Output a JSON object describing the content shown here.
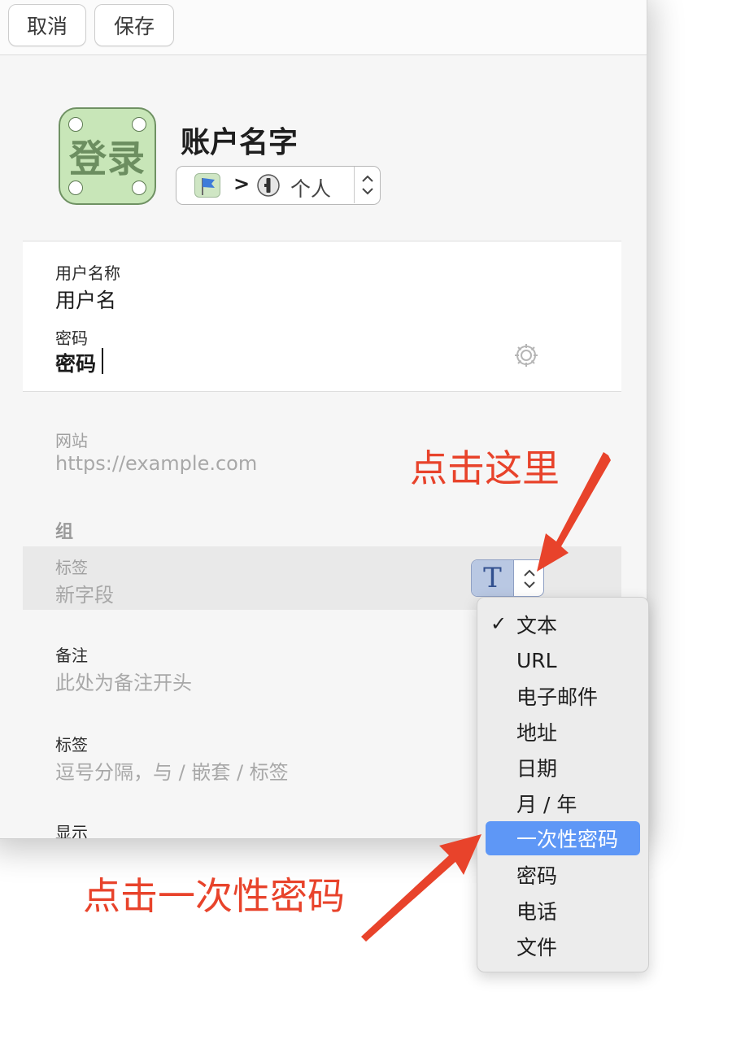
{
  "toolbar": {
    "cancel_label": "取消",
    "save_label": "保存"
  },
  "header": {
    "icon_text": "登录",
    "title": "账户名字",
    "vault": {
      "separator": ">",
      "label": "个人"
    }
  },
  "fields": {
    "username": {
      "label": "用户名称",
      "value": "用户名"
    },
    "password": {
      "label": "密码",
      "value": "密码"
    },
    "website": {
      "label": "网站",
      "placeholder": "https://example.com"
    },
    "section_title": "组",
    "custom": {
      "label": "标签",
      "placeholder": "新字段",
      "type_glyph": "T"
    },
    "notes": {
      "label": "备注",
      "placeholder": "此处为备注开头"
    },
    "tags": {
      "label": "标签",
      "placeholder": "逗号分隔，与 / 嵌套 / 标签"
    },
    "display": {
      "label": "显示"
    }
  },
  "menu": {
    "check": "✓",
    "items": [
      "文本",
      "URL",
      "电子邮件",
      "地址",
      "日期",
      "月 / 年",
      "一次性密码",
      "密码",
      "电话",
      "文件"
    ],
    "checked_index": 0,
    "selected_index": 6
  },
  "annotations": {
    "click_here": "点击这里",
    "click_otp": "点击一次性密码"
  },
  "colors": {
    "annotation": "#e8432b",
    "menu_highlight": "#5e97f6",
    "icon_green": "#c8e6b8"
  }
}
